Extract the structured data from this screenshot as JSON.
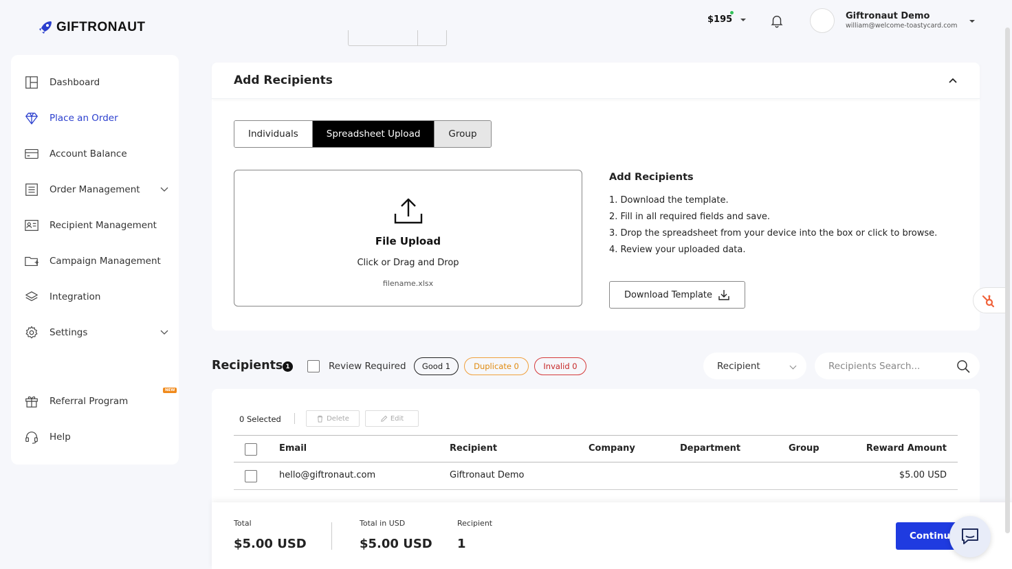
{
  "brand": {
    "name": "GIFTRONAUT",
    "accent": "#2b3fce"
  },
  "header": {
    "balance": "$195",
    "user_name": "Giftronaut Demo",
    "user_email": "william@welcome-toastycard.com"
  },
  "sidebar": {
    "items": [
      {
        "label": "Dashboard",
        "icon": "dashboard-icon"
      },
      {
        "label": "Place an Order",
        "icon": "diamond-icon",
        "active": true
      },
      {
        "label": "Account Balance",
        "icon": "card-icon"
      },
      {
        "label": "Order Management",
        "icon": "list-icon",
        "expandable": true
      },
      {
        "label": "Recipient Management",
        "icon": "contact-card-icon"
      },
      {
        "label": "Campaign Management",
        "icon": "folder-plus-icon"
      },
      {
        "label": "Integration",
        "icon": "layers-icon"
      },
      {
        "label": "Settings",
        "icon": "gear-icon",
        "expandable": true
      },
      {
        "label": "Referral Program",
        "icon": "gift-icon",
        "badge": "NEW"
      },
      {
        "label": "Help",
        "icon": "headset-icon"
      }
    ]
  },
  "add_recipients": {
    "title": "Add Recipients",
    "tabs": [
      "Individuals",
      "Spreadsheet Upload",
      "Group"
    ],
    "active_tab": "Spreadsheet Upload",
    "upload": {
      "title": "File Upload",
      "subtitle": "Click or Drag and Drop",
      "filename": "filename.xlsx"
    },
    "instructions": {
      "title": "Add Recipients",
      "steps": [
        "1. Download the template.",
        "2. Fill in all required fields and save.",
        "3. Drop the spreadsheet from your device into the box or click to browse.",
        "4. Review your uploaded data."
      ]
    },
    "download_label": "Download Template"
  },
  "recipients": {
    "title": "Recipients",
    "count": "1",
    "review_label": "Review Required",
    "pills": {
      "good": "Good 1",
      "duplicate": "Duplicate 0",
      "invalid": "Invalid 0"
    },
    "filter_value": "Recipient",
    "search_placeholder": "Recipients Search...",
    "selected_label": "0  Selected",
    "delete_label": "Delete",
    "edit_label": "Edit",
    "columns": [
      "Email",
      "Recipient",
      "Company",
      "Department",
      "Group",
      "Reward Amount"
    ],
    "rows": [
      {
        "email": "hello@giftronaut.com",
        "recipient": "Giftronaut Demo",
        "company": "",
        "department": "",
        "group": "",
        "reward": "$5.00 USD"
      }
    ]
  },
  "footer": {
    "total_label": "Total",
    "total_value": "$5.00 USD",
    "total_usd_label": "Total in USD",
    "total_usd_value": "$5.00 USD",
    "recipient_label": "Recipient",
    "recipient_value": "1",
    "continue_label": "Continue"
  }
}
